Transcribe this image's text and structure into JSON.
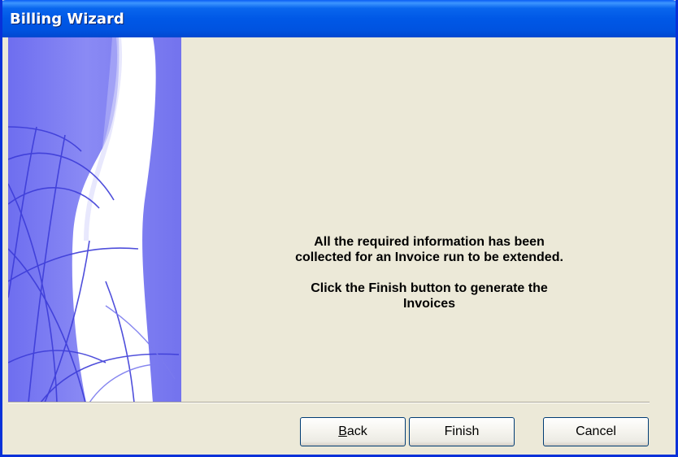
{
  "window": {
    "title": "Billing Wizard"
  },
  "message": {
    "line1": "All the required information has been",
    "line2": "collected for an Invoice run to be extended.",
    "line3": "Click the Finish button to generate the",
    "line4": "Invoices"
  },
  "buttons": {
    "back_mnemonic": "B",
    "back_rest": "ack",
    "finish_label": "Finish",
    "cancel_label": "Cancel"
  },
  "colors": {
    "titlebar": "#0058e6",
    "dialog_bg": "#ece9d8",
    "graphic_blue": "#7b7bf0"
  }
}
